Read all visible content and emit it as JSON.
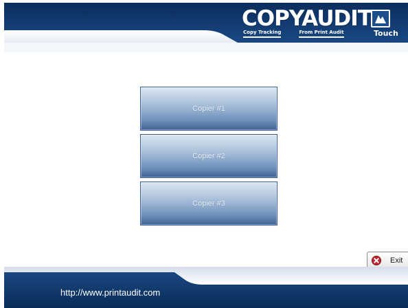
{
  "logo": {
    "main": "COPYAUDIT",
    "tagline_left": "Copy Tracking",
    "tagline_right": "From Print Audit",
    "touch": "Touch"
  },
  "copiers": [
    {
      "label": "Copier #1"
    },
    {
      "label": "Copier #2"
    },
    {
      "label": "Copier #3"
    }
  ],
  "exit": {
    "label": "Exit"
  },
  "footer": {
    "url": "http://www.printaudit.com"
  },
  "colors": {
    "header_dark": "#0e3466",
    "header_light": "#eaf0f6",
    "button_top": "#dbe6f2",
    "button_bottom": "#3f6294",
    "exit_icon": "#c0282d"
  }
}
